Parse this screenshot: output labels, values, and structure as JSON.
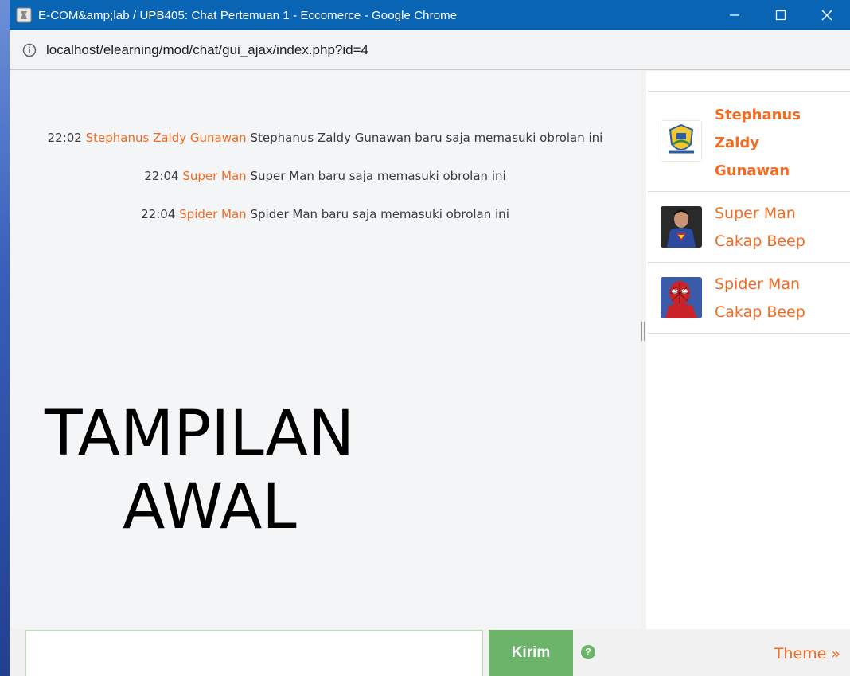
{
  "window": {
    "title": "E-COM&amp;lab / UPB405: Chat Pertemuan 1 - Eccomerce - Google Chrome"
  },
  "address_bar": {
    "url": "localhost/elearning/mod/chat/gui_ajax/index.php?id=4"
  },
  "messages": [
    {
      "time": "22:02",
      "name": "Stephanus Zaldy Gunawan",
      "text": "Stephanus Zaldy Gunawan baru saja memasuki obrolan ini"
    },
    {
      "time": "22:04",
      "name": "Super Man",
      "text": "Super Man baru saja memasuki obrolan ini"
    },
    {
      "time": "22:04",
      "name": "Spider Man",
      "text": "Spider Man baru saja memasuki obrolan ini"
    }
  ],
  "overlay": {
    "line1": "TAMPILAN",
    "line2": "AWAL"
  },
  "users": [
    {
      "name": "Stephanus Zaldy Gunawan",
      "avatar": "crest-logo",
      "self": true,
      "beep": ""
    },
    {
      "name": "Super Man",
      "avatar": "superman-photo",
      "self": false,
      "beep": "Cakap Beep"
    },
    {
      "name": "Spider Man",
      "avatar": "spiderman-photo",
      "self": false,
      "beep": "Cakap Beep"
    }
  ],
  "input": {
    "value": "",
    "send_label": "Kirim",
    "help_icon": "question-circle-icon",
    "theme_label": "Theme »"
  },
  "colors": {
    "accent_orange": "#f26b21",
    "send_green": "#6cb46a",
    "titlebar_blue": "#0a64b4"
  }
}
